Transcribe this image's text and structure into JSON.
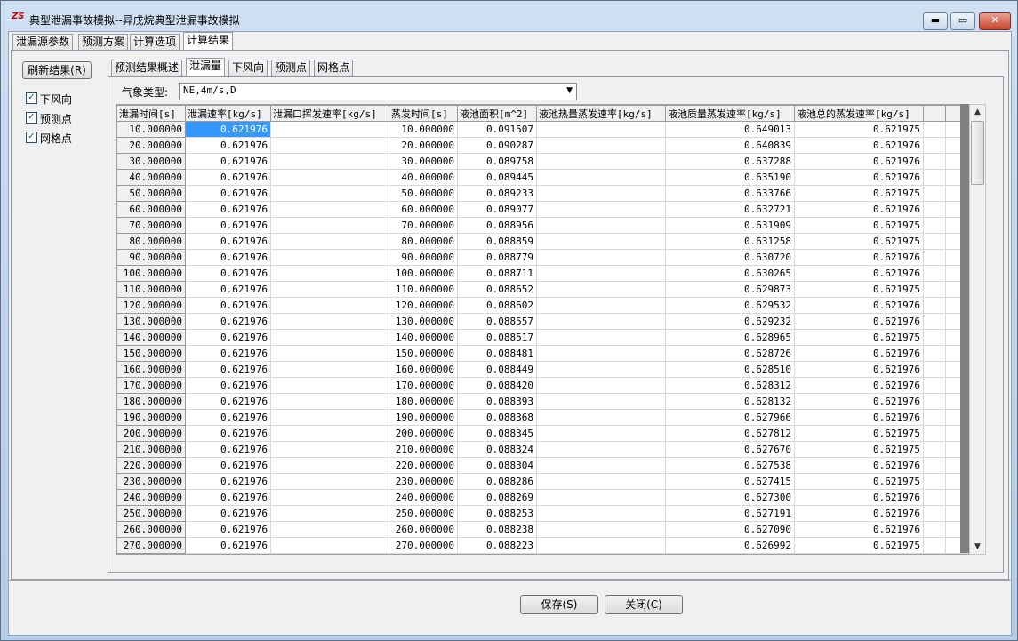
{
  "window": {
    "title": "典型泄漏事故模拟--异戊烷典型泄漏事故模拟",
    "app_icon": "ZS",
    "min_label": "▬",
    "max_label": "▭",
    "close_label": "✕"
  },
  "main_tabs": [
    "泄漏源参数",
    "预测方案",
    "计算选项",
    "计算结果"
  ],
  "sidebar": {
    "refresh_label": "刷新结果(R)",
    "checkboxes": [
      {
        "label": "下风向",
        "checked": true
      },
      {
        "label": "预测点",
        "checked": true
      },
      {
        "label": "网格点",
        "checked": true
      }
    ]
  },
  "sub_tabs": [
    "预测结果概述",
    "泄漏量",
    "下风向",
    "预测点",
    "网格点"
  ],
  "weather": {
    "label": "气象类型:",
    "value": "NE,4m/s,D"
  },
  "table": {
    "columns": [
      "泄漏时间[s]",
      "泄漏速率[kg/s]",
      "泄漏口挥发速率[kg/s]",
      "蒸发时间[s]",
      "液池面积[m^2]",
      "液池热量蒸发速率[kg/s]",
      "液池质量蒸发速率[kg/s]",
      "液池总的蒸发速率[kg/s]"
    ],
    "rows": [
      [
        "10.000000",
        "0.621976",
        "",
        "10.000000",
        "0.091507",
        "",
        "0.649013",
        "0.621975"
      ],
      [
        "20.000000",
        "0.621976",
        "",
        "20.000000",
        "0.090287",
        "",
        "0.640839",
        "0.621976"
      ],
      [
        "30.000000",
        "0.621976",
        "",
        "30.000000",
        "0.089758",
        "",
        "0.637288",
        "0.621976"
      ],
      [
        "40.000000",
        "0.621976",
        "",
        "40.000000",
        "0.089445",
        "",
        "0.635190",
        "0.621976"
      ],
      [
        "50.000000",
        "0.621976",
        "",
        "50.000000",
        "0.089233",
        "",
        "0.633766",
        "0.621975"
      ],
      [
        "60.000000",
        "0.621976",
        "",
        "60.000000",
        "0.089077",
        "",
        "0.632721",
        "0.621976"
      ],
      [
        "70.000000",
        "0.621976",
        "",
        "70.000000",
        "0.088956",
        "",
        "0.631909",
        "0.621975"
      ],
      [
        "80.000000",
        "0.621976",
        "",
        "80.000000",
        "0.088859",
        "",
        "0.631258",
        "0.621975"
      ],
      [
        "90.000000",
        "0.621976",
        "",
        "90.000000",
        "0.088779",
        "",
        "0.630720",
        "0.621976"
      ],
      [
        "100.000000",
        "0.621976",
        "",
        "100.000000",
        "0.088711",
        "",
        "0.630265",
        "0.621976"
      ],
      [
        "110.000000",
        "0.621976",
        "",
        "110.000000",
        "0.088652",
        "",
        "0.629873",
        "0.621975"
      ],
      [
        "120.000000",
        "0.621976",
        "",
        "120.000000",
        "0.088602",
        "",
        "0.629532",
        "0.621976"
      ],
      [
        "130.000000",
        "0.621976",
        "",
        "130.000000",
        "0.088557",
        "",
        "0.629232",
        "0.621976"
      ],
      [
        "140.000000",
        "0.621976",
        "",
        "140.000000",
        "0.088517",
        "",
        "0.628965",
        "0.621975"
      ],
      [
        "150.000000",
        "0.621976",
        "",
        "150.000000",
        "0.088481",
        "",
        "0.628726",
        "0.621976"
      ],
      [
        "160.000000",
        "0.621976",
        "",
        "160.000000",
        "0.088449",
        "",
        "0.628510",
        "0.621976"
      ],
      [
        "170.000000",
        "0.621976",
        "",
        "170.000000",
        "0.088420",
        "",
        "0.628312",
        "0.621976"
      ],
      [
        "180.000000",
        "0.621976",
        "",
        "180.000000",
        "0.088393",
        "",
        "0.628132",
        "0.621976"
      ],
      [
        "190.000000",
        "0.621976",
        "",
        "190.000000",
        "0.088368",
        "",
        "0.627966",
        "0.621976"
      ],
      [
        "200.000000",
        "0.621976",
        "",
        "200.000000",
        "0.088345",
        "",
        "0.627812",
        "0.621975"
      ],
      [
        "210.000000",
        "0.621976",
        "",
        "210.000000",
        "0.088324",
        "",
        "0.627670",
        "0.621975"
      ],
      [
        "220.000000",
        "0.621976",
        "",
        "220.000000",
        "0.088304",
        "",
        "0.627538",
        "0.621976"
      ],
      [
        "230.000000",
        "0.621976",
        "",
        "230.000000",
        "0.088286",
        "",
        "0.627415",
        "0.621975"
      ],
      [
        "240.000000",
        "0.621976",
        "",
        "240.000000",
        "0.088269",
        "",
        "0.627300",
        "0.621976"
      ],
      [
        "250.000000",
        "0.621976",
        "",
        "250.000000",
        "0.088253",
        "",
        "0.627191",
        "0.621976"
      ],
      [
        "260.000000",
        "0.621976",
        "",
        "260.000000",
        "0.088238",
        "",
        "0.627090",
        "0.621976"
      ],
      [
        "270.000000",
        "0.621976",
        "",
        "270.000000",
        "0.088223",
        "",
        "0.626992",
        "0.621975"
      ]
    ]
  },
  "footer": {
    "save_label": "保存(S)",
    "close_label": "关闭(C)"
  }
}
